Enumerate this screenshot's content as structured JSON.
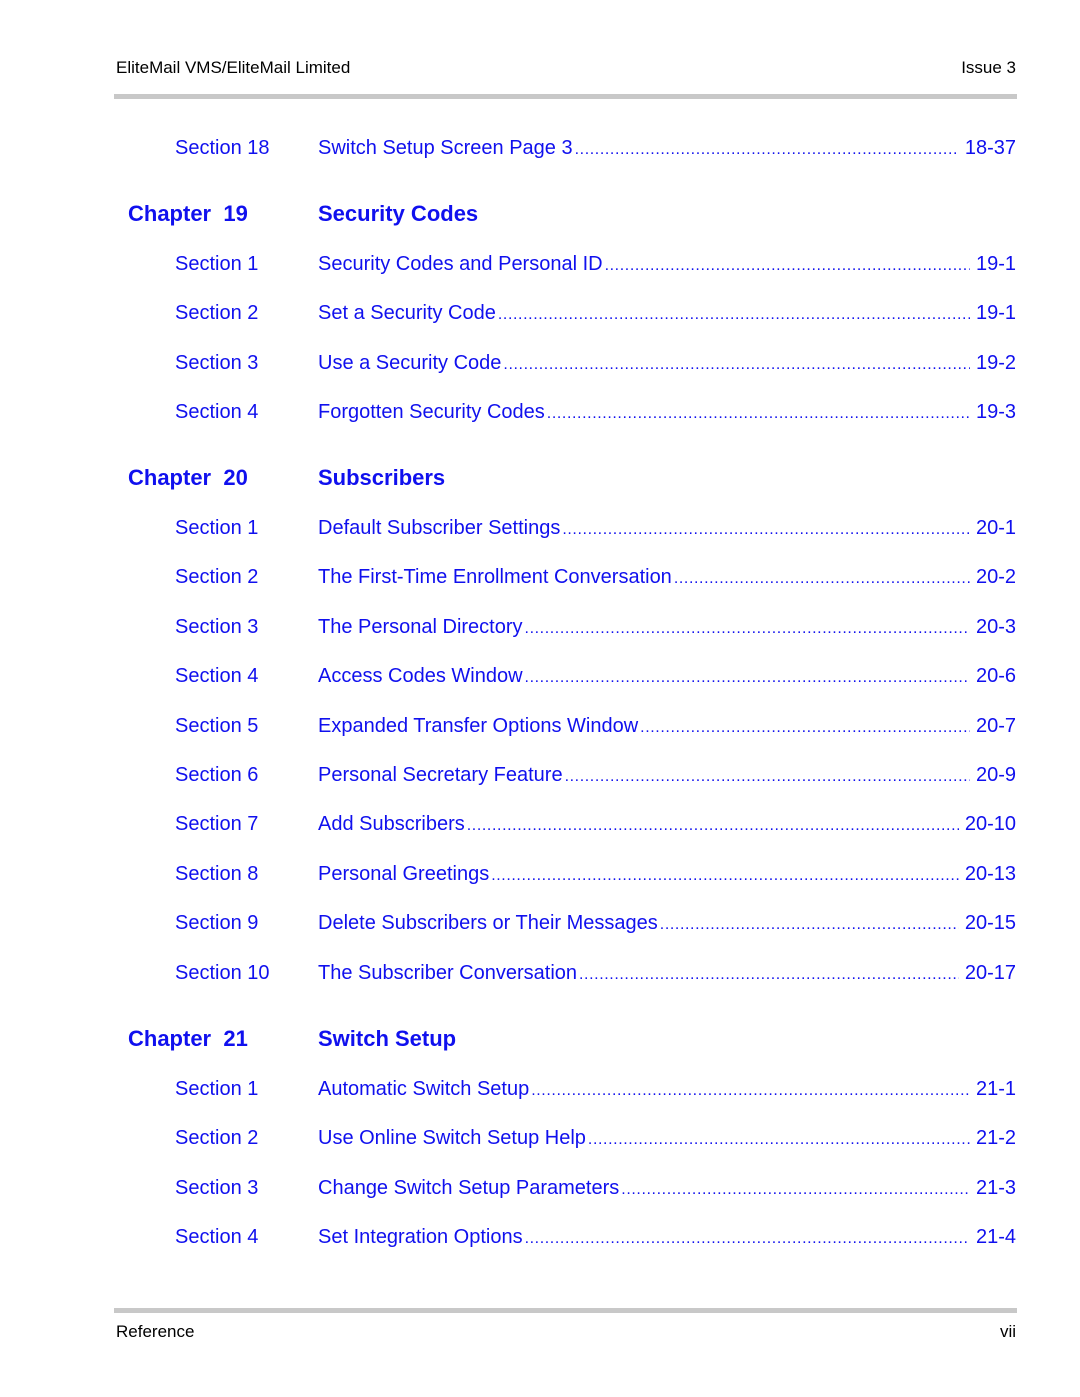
{
  "header": {
    "left": "EliteMail VMS/EliteMail Limited",
    "right": "Issue 3"
  },
  "footer": {
    "left": "Reference",
    "right": "vii"
  },
  "toc": {
    "lead_entries": [
      {
        "section": "Section 18",
        "title": "Switch Setup Screen Page 3",
        "page": "18-37"
      }
    ],
    "chapters": [
      {
        "label": "Chapter  19",
        "title": "Security Codes",
        "entries": [
          {
            "section": "Section 1",
            "title": "Security Codes and Personal ID",
            "page": "19-1"
          },
          {
            "section": "Section 2",
            "title": "Set a Security Code",
            "page": "19-1"
          },
          {
            "section": "Section 3",
            "title": "Use a Security Code",
            "page": "19-2"
          },
          {
            "section": "Section 4",
            "title": "Forgotten Security Codes",
            "page": "19-3"
          }
        ]
      },
      {
        "label": "Chapter  20",
        "title": "Subscribers",
        "entries": [
          {
            "section": "Section 1",
            "title": "Default Subscriber Settings",
            "page": "20-1"
          },
          {
            "section": "Section 2",
            "title": "The First-Time Enrollment Conversation",
            "page": "20-2"
          },
          {
            "section": "Section 3",
            "title": "The Personal Directory",
            "page": "20-3"
          },
          {
            "section": "Section 4",
            "title": "Access Codes Window",
            "page": "20-6"
          },
          {
            "section": "Section 5",
            "title": "Expanded Transfer Options Window",
            "page": "20-7"
          },
          {
            "section": "Section 6",
            "title": "Personal Secretary Feature",
            "page": "20-9"
          },
          {
            "section": "Section 7",
            "title": "Add Subscribers",
            "page": "20-10"
          },
          {
            "section": "Section 8",
            "title": "Personal Greetings",
            "page": "20-13"
          },
          {
            "section": "Section 9",
            "title": "Delete Subscribers or Their Messages",
            "page": "20-15"
          },
          {
            "section": "Section 10",
            "title": "The Subscriber Conversation",
            "page": "20-17"
          }
        ]
      },
      {
        "label": "Chapter  21",
        "title": "Switch Setup",
        "entries": [
          {
            "section": "Section 1",
            "title": "Automatic Switch Setup",
            "page": "21-1"
          },
          {
            "section": "Section 2",
            "title": "Use Online Switch Setup Help",
            "page": "21-2"
          },
          {
            "section": "Section 3",
            "title": "Change Switch Setup Parameters",
            "page": "21-3"
          },
          {
            "section": "Section 4",
            "title": "Set Integration Options",
            "page": "21-4"
          }
        ]
      }
    ]
  },
  "colors": {
    "link": "#1010ee",
    "rule": "#c8c8c8",
    "text": "#000000"
  }
}
